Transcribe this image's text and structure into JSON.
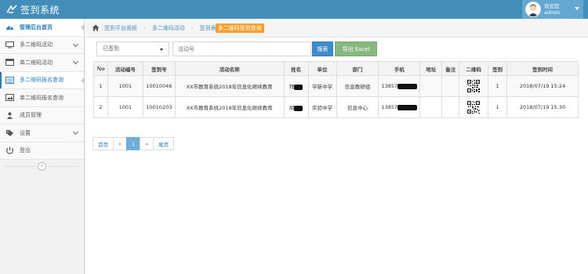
{
  "app": {
    "title": "签到系统"
  },
  "user": {
    "greeting": "欢迎您",
    "name": "admin"
  },
  "sidebar": {
    "items": [
      {
        "label": "管理后台首页",
        "icon": "dashboard-icon",
        "has_children": false
      },
      {
        "label": "多二维码活动",
        "icon": "desktop-icon",
        "has_children": true
      },
      {
        "label": "单二维码活动",
        "icon": "list-icon",
        "has_children": true
      },
      {
        "label": "多二维码报名查询",
        "icon": "list-alt-icon",
        "has_children": false
      },
      {
        "label": "单二维码报名查询",
        "icon": "picture-icon",
        "has_children": false
      },
      {
        "label": "成员管理",
        "icon": "user-icon",
        "has_children": false
      },
      {
        "label": "设置",
        "icon": "tag-icon",
        "has_children": true
      },
      {
        "label": "登出",
        "icon": "power-icon",
        "has_children": false
      }
    ]
  },
  "breadcrumb": {
    "items": [
      "签到平台面板",
      "多二维码活动",
      "签到表"
    ],
    "current": "多二维码签到查询"
  },
  "search": {
    "status_value": "已签到",
    "placeholder": "活动号",
    "search_label": "搜索",
    "export_label": "导出 Excel"
  },
  "table": {
    "headers": [
      "No",
      "活动编号",
      "签到号",
      "活动名称",
      "姓名",
      "单位",
      "部门",
      "手机",
      "地址",
      "备注",
      "二维码",
      "签到",
      "签到时间"
    ],
    "rows": [
      {
        "no": "1",
        "activity_id": "1001",
        "sign_id": "10010046",
        "activity_name": "XX市教育系统2018年信息化继续教育",
        "name": "拜",
        "unit": "学新中学",
        "dept": "信息教研组",
        "phone": "13857",
        "address": "",
        "remark": "",
        "signed": "1",
        "time": "2018/07/19 15:24"
      },
      {
        "no": "2",
        "activity_id": "1001",
        "sign_id": "10010203",
        "activity_name": "XX市教育系统2018年信息化继续教育",
        "name": "胡",
        "unit": "实验中学",
        "dept": "信息中心",
        "phone": "13857",
        "address": "",
        "remark": "",
        "signed": "1",
        "time": "2018/07/19 15:30"
      }
    ]
  },
  "pagination": {
    "first": "首页",
    "prev": "«",
    "current": "1",
    "next": "»",
    "last": "尾页"
  },
  "colors": {
    "navbar": "#438eb9",
    "accent": "#2b7dbc",
    "tag": "#f79e2e",
    "search": "#428bca",
    "export": "#87b87f"
  }
}
